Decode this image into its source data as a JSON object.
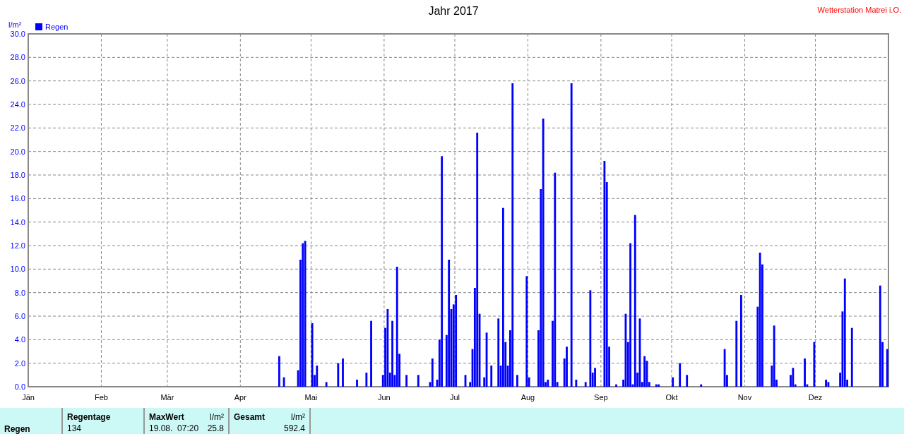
{
  "header": {
    "station": "Wetterstation Matrei i.O."
  },
  "chart": {
    "chart_data": {
      "type": "bar",
      "title": "Jahr 2017",
      "ylabel": "l/m²",
      "categories": [
        "Jän",
        null,
        null,
        null,
        null,
        null,
        null,
        null,
        null,
        null,
        null,
        null,
        null,
        null,
        null,
        null,
        null,
        null,
        null,
        null,
        null,
        null,
        null,
        null,
        null,
        null,
        null,
        null,
        null,
        null,
        null,
        "Feb",
        null,
        null,
        null,
        null,
        null,
        null,
        null,
        null,
        null,
        null,
        null,
        null,
        null,
        null,
        null,
        null,
        null,
        null,
        null,
        null,
        null,
        null,
        null,
        null,
        null,
        null,
        null,
        "Mär",
        null,
        null,
        null,
        null,
        null,
        null,
        null,
        null,
        null,
        null,
        null,
        null,
        null,
        null,
        null,
        null,
        null,
        null,
        null,
        null,
        null,
        null,
        null,
        null,
        null,
        null,
        null,
        null,
        null,
        null,
        "Apr",
        null,
        null,
        null,
        null,
        null,
        null,
        null,
        null,
        null,
        null,
        null,
        null,
        null,
        null,
        null,
        null,
        null,
        null,
        null,
        null,
        null,
        null,
        null,
        null,
        null,
        null,
        null,
        null,
        null,
        "Mai",
        null,
        null,
        null,
        null,
        null,
        null,
        null,
        null,
        null,
        null,
        null,
        null,
        null,
        null,
        null,
        null,
        null,
        null,
        null,
        null,
        null,
        null,
        null,
        null,
        null,
        null,
        null,
        null,
        null,
        null,
        "Jun",
        null,
        null,
        null,
        null,
        null,
        null,
        null,
        null,
        null,
        null,
        null,
        null,
        null,
        null,
        null,
        null,
        null,
        null,
        null,
        null,
        null,
        null,
        null,
        null,
        null,
        null,
        null,
        null,
        null,
        "Jul",
        null,
        null,
        null,
        null,
        null,
        null,
        null,
        null,
        null,
        null,
        null,
        null,
        null,
        null,
        null,
        null,
        null,
        null,
        null,
        null,
        null,
        null,
        null,
        null,
        null,
        null,
        null,
        null,
        null,
        null,
        "Aug",
        null,
        null,
        null,
        null,
        null,
        null,
        null,
        null,
        null,
        null,
        null,
        null,
        null,
        null,
        null,
        null,
        null,
        null,
        null,
        null,
        null,
        null,
        null,
        null,
        null,
        null,
        null,
        null,
        null,
        null,
        "Sep",
        null,
        null,
        null,
        null,
        null,
        null,
        null,
        null,
        null,
        null,
        null,
        null,
        null,
        null,
        null,
        null,
        null,
        null,
        null,
        null,
        null,
        null,
        null,
        null,
        null,
        null,
        null,
        null,
        null,
        "Okt",
        null,
        null,
        null,
        null,
        null,
        null,
        null,
        null,
        null,
        null,
        null,
        null,
        null,
        null,
        null,
        null,
        null,
        null,
        null,
        null,
        null,
        null,
        null,
        null,
        null,
        null,
        null,
        null,
        null,
        null,
        "Nov",
        null,
        null,
        null,
        null,
        null,
        null,
        null,
        null,
        null,
        null,
        null,
        null,
        null,
        null,
        null,
        null,
        null,
        null,
        null,
        null,
        null,
        null,
        null,
        null,
        null,
        null,
        null,
        null,
        null,
        "Dez",
        null,
        null,
        null,
        null,
        null,
        null,
        null,
        null,
        null,
        null,
        null,
        null,
        null,
        null,
        null,
        null,
        null,
        null,
        null,
        null,
        null,
        null,
        null,
        null,
        null,
        null,
        null,
        null,
        null,
        null
      ],
      "series": [
        {
          "name": "Regen",
          "color": "#0000ff",
          "values": [
            0,
            0,
            0,
            0,
            0,
            0,
            0,
            0,
            0,
            0,
            0,
            0,
            0,
            0,
            0,
            0,
            0,
            0,
            0,
            0,
            0,
            0,
            0,
            0,
            0,
            0,
            0,
            0,
            0,
            0,
            0,
            0,
            0,
            0,
            0,
            0,
            0,
            0,
            0,
            0,
            0,
            0,
            0,
            0,
            0,
            0,
            0,
            0,
            0,
            0,
            0,
            0,
            0,
            0,
            0,
            0,
            0,
            0,
            0,
            0,
            0,
            0,
            0,
            0,
            0,
            0,
            0,
            0,
            0,
            0,
            0,
            0,
            0,
            0,
            0,
            0,
            0,
            0,
            0,
            0,
            0,
            0,
            0,
            0,
            0,
            0,
            0,
            0,
            0,
            0,
            0,
            0,
            0,
            0,
            0,
            0,
            0,
            0,
            0,
            0,
            0,
            0,
            0,
            0,
            0,
            0,
            2.6,
            0,
            0.8,
            0,
            0,
            0,
            0,
            0,
            1.4,
            10.8,
            12.2,
            12.4,
            0,
            0,
            5.4,
            1.0,
            1.8,
            0,
            0,
            0,
            0.4,
            0,
            0,
            0,
            0,
            2.0,
            0,
            2.4,
            0,
            0,
            0,
            0,
            0,
            0.6,
            0,
            0,
            0,
            1.2,
            0,
            5.6,
            0,
            0,
            0,
            0,
            1.0,
            5.0,
            6.6,
            1.2,
            5.6,
            1.0,
            10.2,
            2.8,
            0,
            0,
            1.0,
            0,
            0,
            0,
            0,
            1.0,
            0,
            0,
            0,
            0,
            0.4,
            2.4,
            0,
            0.6,
            4.0,
            19.6,
            0,
            4.4,
            10.8,
            6.6,
            7.0,
            7.8,
            0,
            0,
            0,
            1.0,
            0,
            0.4,
            3.2,
            8.4,
            21.6,
            6.2,
            0,
            0.8,
            4.6,
            0,
            1.8,
            0,
            0,
            5.8,
            1.8,
            15.2,
            3.8,
            1.8,
            4.8,
            25.8,
            0,
            1.0,
            0,
            0,
            0,
            9.4,
            0.8,
            0,
            0,
            0,
            4.8,
            16.8,
            22.8,
            0.4,
            0.6,
            0,
            5.6,
            18.2,
            0.4,
            0,
            0,
            2.4,
            3.4,
            0,
            25.8,
            0,
            0.6,
            0,
            0,
            0,
            0.4,
            0,
            8.2,
            1.2,
            1.6,
            0,
            0,
            0,
            19.2,
            17.4,
            3.4,
            0,
            0,
            0.2,
            0,
            0,
            0.6,
            6.2,
            3.8,
            12.2,
            0.2,
            14.6,
            1.2,
            5.8,
            0.4,
            2.6,
            2.2,
            0.4,
            0,
            0,
            0.2,
            0.2,
            0,
            0,
            0,
            0,
            0,
            0.8,
            0,
            0,
            2.0,
            0,
            0,
            1.0,
            0,
            0,
            0,
            0,
            0,
            0.2,
            0,
            0,
            0,
            0,
            0,
            0,
            0,
            0,
            0,
            3.2,
            1.0,
            0,
            0,
            0,
            5.6,
            0,
            7.8,
            0,
            0,
            0,
            0,
            0,
            0,
            6.8,
            11.4,
            10.4,
            0,
            0,
            0,
            1.8,
            5.2,
            0.6,
            0,
            0,
            0,
            0,
            0,
            1.0,
            1.6,
            0.2,
            0,
            0,
            0,
            2.4,
            0.2,
            0,
            0,
            3.8,
            0,
            0,
            0,
            0,
            0.6,
            0.4,
            0,
            0,
            0,
            0,
            1.2,
            6.4,
            9.2,
            0.6,
            0,
            5.0,
            0,
            0,
            0,
            0,
            0,
            0,
            0,
            0,
            0,
            0,
            0,
            8.6,
            3.8,
            0,
            3.2
          ]
        }
      ],
      "ylim": [
        0,
        30
      ],
      "grid": true,
      "yticks": [
        {
          "value": 0,
          "label": "0.0"
        },
        {
          "value": 2,
          "label": "2.0"
        },
        {
          "value": 4,
          "label": "4.0"
        },
        {
          "value": 6,
          "label": "6.0"
        },
        {
          "value": 8,
          "label": "8.0"
        },
        {
          "value": 10,
          "label": "10.0"
        },
        {
          "value": 12,
          "label": "12.0"
        },
        {
          "value": 14,
          "label": "14.0"
        },
        {
          "value": 16,
          "label": "16.0"
        },
        {
          "value": 18,
          "label": "18.0"
        },
        {
          "value": 20,
          "label": "20.0"
        },
        {
          "value": 22,
          "label": "22.0"
        },
        {
          "value": 24,
          "label": "24.0"
        },
        {
          "value": 26,
          "label": "26.0"
        },
        {
          "value": 28,
          "label": "28.0"
        },
        {
          "value": 30,
          "label": "30.0"
        }
      ]
    }
  },
  "summary": {
    "row_label": "Regen",
    "groups": [
      {
        "heading": "Regentage",
        "values": [
          "134"
        ],
        "kind": "count"
      },
      {
        "heading": "MaxWert",
        "unit": "l/m²",
        "values": [
          "19.08.  07:20",
          "25.8"
        ],
        "kind": "peak"
      },
      {
        "heading": "Gesamt",
        "unit": "l/m²",
        "values": [
          "592.4"
        ],
        "kind": "total"
      }
    ]
  }
}
